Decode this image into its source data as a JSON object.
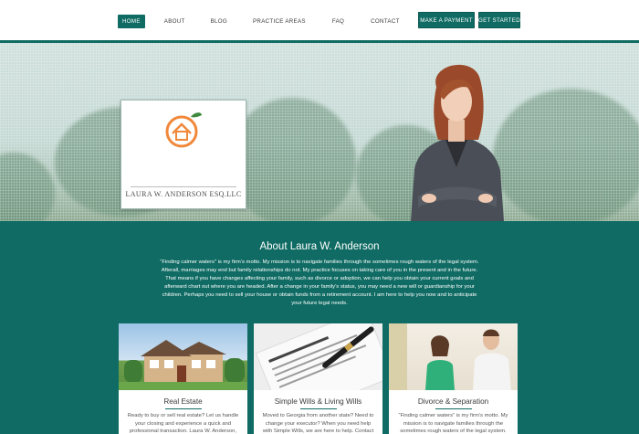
{
  "nav": {
    "items": [
      {
        "label": "HOME",
        "active": true
      },
      {
        "label": "ABOUT"
      },
      {
        "label": "BLOG"
      },
      {
        "label": "PRACTICE AREAS"
      },
      {
        "label": "FAQ"
      },
      {
        "label": "CONTACT"
      }
    ],
    "make_payment": "MAKE A PAYMENT",
    "get_started": "GET STARTED"
  },
  "hero": {
    "logo_text": "LAURA W. ANDERSON ESQ.LLC"
  },
  "about": {
    "title": "About Laura W. Anderson",
    "body": "“Finding calmer waters” is my firm’s motto. My mission is to navigate families through the sometimes rough waters of the legal system. Afterall, marriages may end but family relationships do not. My practice focuses on taking care of you in the present and in the future. That means if you have changes affecting your family, such as divorce or adoption, we can help you obtain your current goals and afterward chart out where you are headed. After a change in your family’s status, you may need a new will or guardianship for your children. Perhaps you need to sell your house or obtain funds from a retirement account. I am here to help you now and to anticipate your future legal needs."
  },
  "cards": [
    {
      "title": "Real Estate",
      "text": "Ready to buy or sell real estate? Let us handle your closing and experience a quick and professional transaction. Laura W. Anderson,"
    },
    {
      "title": "Simple Wills & Living Wills",
      "text": "Moved to Georgia from another state? Need to change your executor? When you need help with Simple Wills, we are here to help. Contact"
    },
    {
      "title": "Divorce & Separation",
      "text": "“Finding calmer waters” is my firm’s motto. My mission is to navigate families through the sometimes rough waters of the legal system."
    }
  ],
  "colors": {
    "brand": "#0f6b63",
    "logo_orange": "#f0883a"
  }
}
